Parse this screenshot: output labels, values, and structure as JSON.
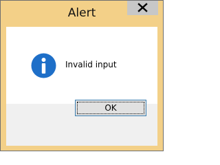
{
  "window": {
    "title": "Alert",
    "close_icon": "close-icon"
  },
  "message": {
    "icon": "info-icon",
    "text": "Invalid input"
  },
  "buttons": {
    "ok_label": "OK"
  },
  "colors": {
    "title_bar": "#f3d088",
    "info_icon": "#1e6fc8",
    "close_button": "#c7c7c7",
    "button_border": "#3c7fb1"
  }
}
